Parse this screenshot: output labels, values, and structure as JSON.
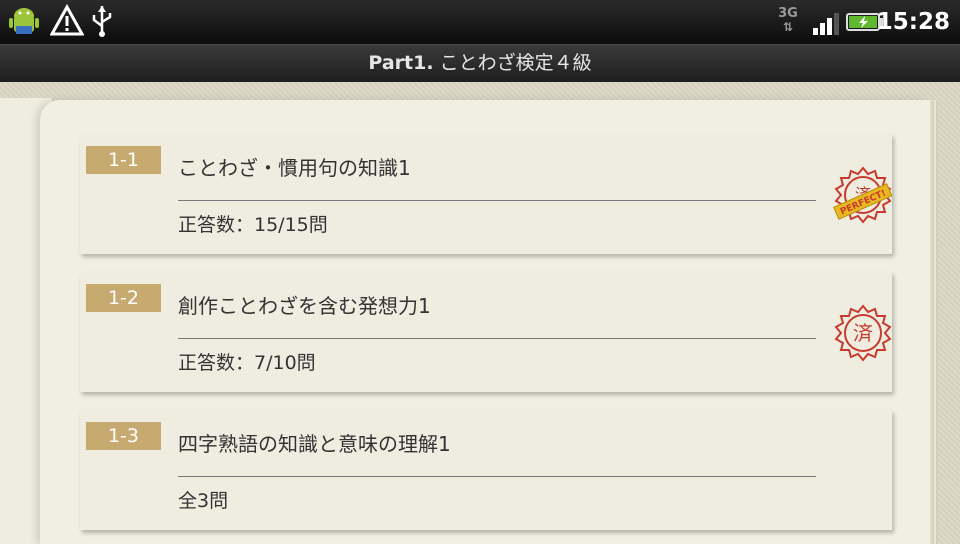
{
  "status_bar": {
    "time": "15:28",
    "network": "3G",
    "icons": [
      "android-icon",
      "warning-icon",
      "usb-icon",
      "network-3g-icon",
      "signal-icon",
      "battery-charging-icon"
    ]
  },
  "header": {
    "part": "Part1.",
    "title": " ことわざ検定４級"
  },
  "sections": [
    {
      "id": "1-1",
      "title": "ことわざ・慣用句の知識1",
      "status": "正答数：15/15問",
      "stamp": "perfect",
      "stamp_text": "PERFECT!"
    },
    {
      "id": "1-2",
      "title": "創作ことわざを含む発想力1",
      "status": "正答数：7/10問",
      "stamp": "done"
    },
    {
      "id": "1-3",
      "title": "四字熟語の知識と意味の理解1",
      "status": "全3問",
      "stamp": "none"
    }
  ],
  "colors": {
    "badge": "#c7aa70",
    "stamp_red": "#c93a2e",
    "stamp_ribbon": "#e8b820",
    "page": "#f1efe2"
  }
}
